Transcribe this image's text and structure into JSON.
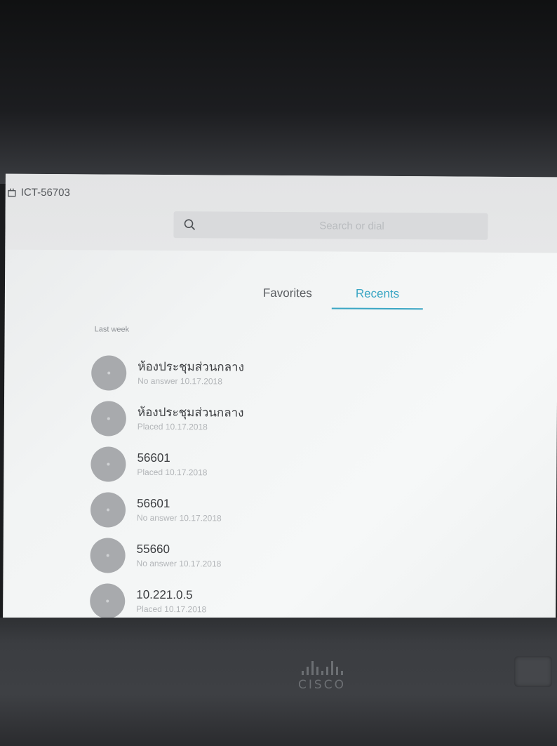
{
  "device": {
    "name": "ICT-56703",
    "icon": "device-icon"
  },
  "search": {
    "placeholder": "Search or dial",
    "icon": "search-icon"
  },
  "tabs": [
    {
      "label": "Favorites",
      "active": false
    },
    {
      "label": "Recents",
      "active": true
    }
  ],
  "recents": {
    "section_label": "Last week",
    "items": [
      {
        "title": "ห้องประชุมส่วนกลาง",
        "status": "No answer 10.17.2018"
      },
      {
        "title": "ห้องประชุมส่วนกลาง",
        "status": "Placed 10.17.2018"
      },
      {
        "title": "56601",
        "status": "Placed 10.17.2018"
      },
      {
        "title": "56601",
        "status": "No answer 10.17.2018"
      },
      {
        "title": "55660",
        "status": "No answer 10.17.2018"
      },
      {
        "title": "10.221.0.5",
        "status": "Placed 10.17.2018"
      }
    ]
  },
  "branding": {
    "logo_text": "CISCO"
  },
  "colors": {
    "accent": "#3aa6c4",
    "avatar": "#a8aaad"
  }
}
